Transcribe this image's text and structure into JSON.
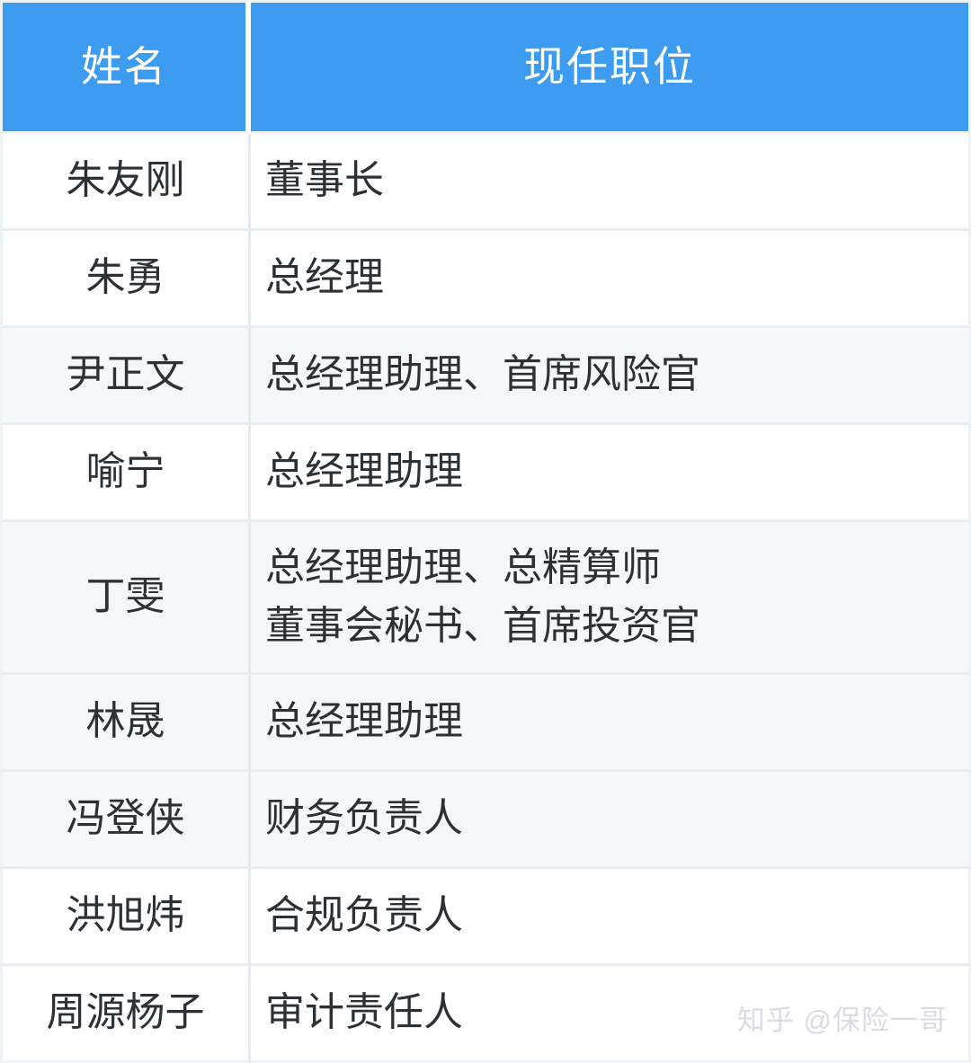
{
  "table": {
    "columns": [
      {
        "key": "name",
        "label": "姓名"
      },
      {
        "key": "position",
        "label": "现任职位"
      }
    ],
    "header_bg": "#3d9bf0",
    "header_text_color": "#ffffff",
    "alt_row_bg": "#f4f8fc",
    "base_row_bg": "#ffffff",
    "border_color": "#e9edf1",
    "text_color": "#2c3136",
    "rows": [
      {
        "name": "朱友刚",
        "position_lines": [
          "董事长"
        ],
        "shaded": false
      },
      {
        "name": "朱勇",
        "position_lines": [
          "总经理"
        ],
        "shaded": false
      },
      {
        "name": "尹正文",
        "position_lines": [
          "总经理助理、首席风险官"
        ],
        "shaded": true
      },
      {
        "name": "喻宁",
        "position_lines": [
          "总经理助理"
        ],
        "shaded": false
      },
      {
        "name": "丁雯",
        "position_lines": [
          "总经理助理、总精算师",
          "董事会秘书、首席投资官"
        ],
        "shaded": true
      },
      {
        "name": "林晟",
        "position_lines": [
          "总经理助理"
        ],
        "shaded": true
      },
      {
        "name": "冯登侠",
        "position_lines": [
          "财务负责人"
        ],
        "shaded": true
      },
      {
        "name": "洪旭炜",
        "position_lines": [
          "合规负责人"
        ],
        "shaded": false
      },
      {
        "name": "周源杨子",
        "position_lines": [
          "审计责任人"
        ],
        "shaded": false
      }
    ]
  },
  "watermark": {
    "text": "知乎 @保险一哥",
    "color": "#d9dde1"
  }
}
